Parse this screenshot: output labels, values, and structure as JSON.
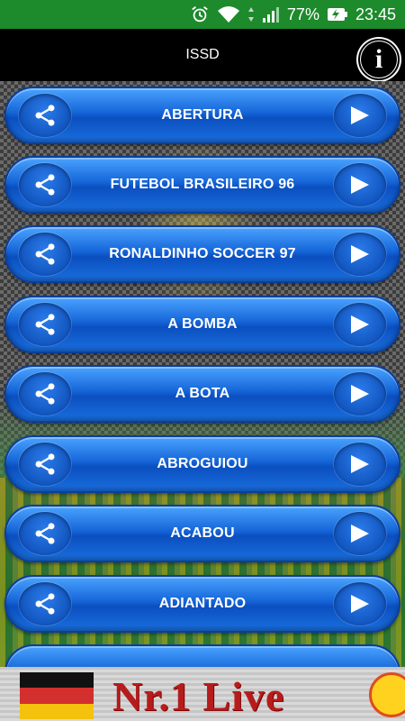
{
  "status": {
    "battery_percent": "77%",
    "time": "23:45",
    "icons": [
      "alarm-icon",
      "wifi-icon",
      "cell-signal-icon",
      "battery-charging-icon"
    ]
  },
  "header": {
    "title": "ISSD",
    "info_icon": "info-icon",
    "info_glyph": "i"
  },
  "sounds": [
    {
      "label": "ABERTURA"
    },
    {
      "label": "FUTEBOL BRASILEIRO 96"
    },
    {
      "label": "RONALDINHO SOCCER 97"
    },
    {
      "label": "A BOMBA"
    },
    {
      "label": "A BOTA"
    },
    {
      "label": "ABROGUIOU"
    },
    {
      "label": "ACABOU"
    },
    {
      "label": "ADIANTADO"
    }
  ],
  "ad": {
    "text": "Nr.1 Live"
  },
  "colors": {
    "status_bar": "#1d8a2c",
    "button_blue": "#1565d8",
    "title_bar": "#000000"
  }
}
